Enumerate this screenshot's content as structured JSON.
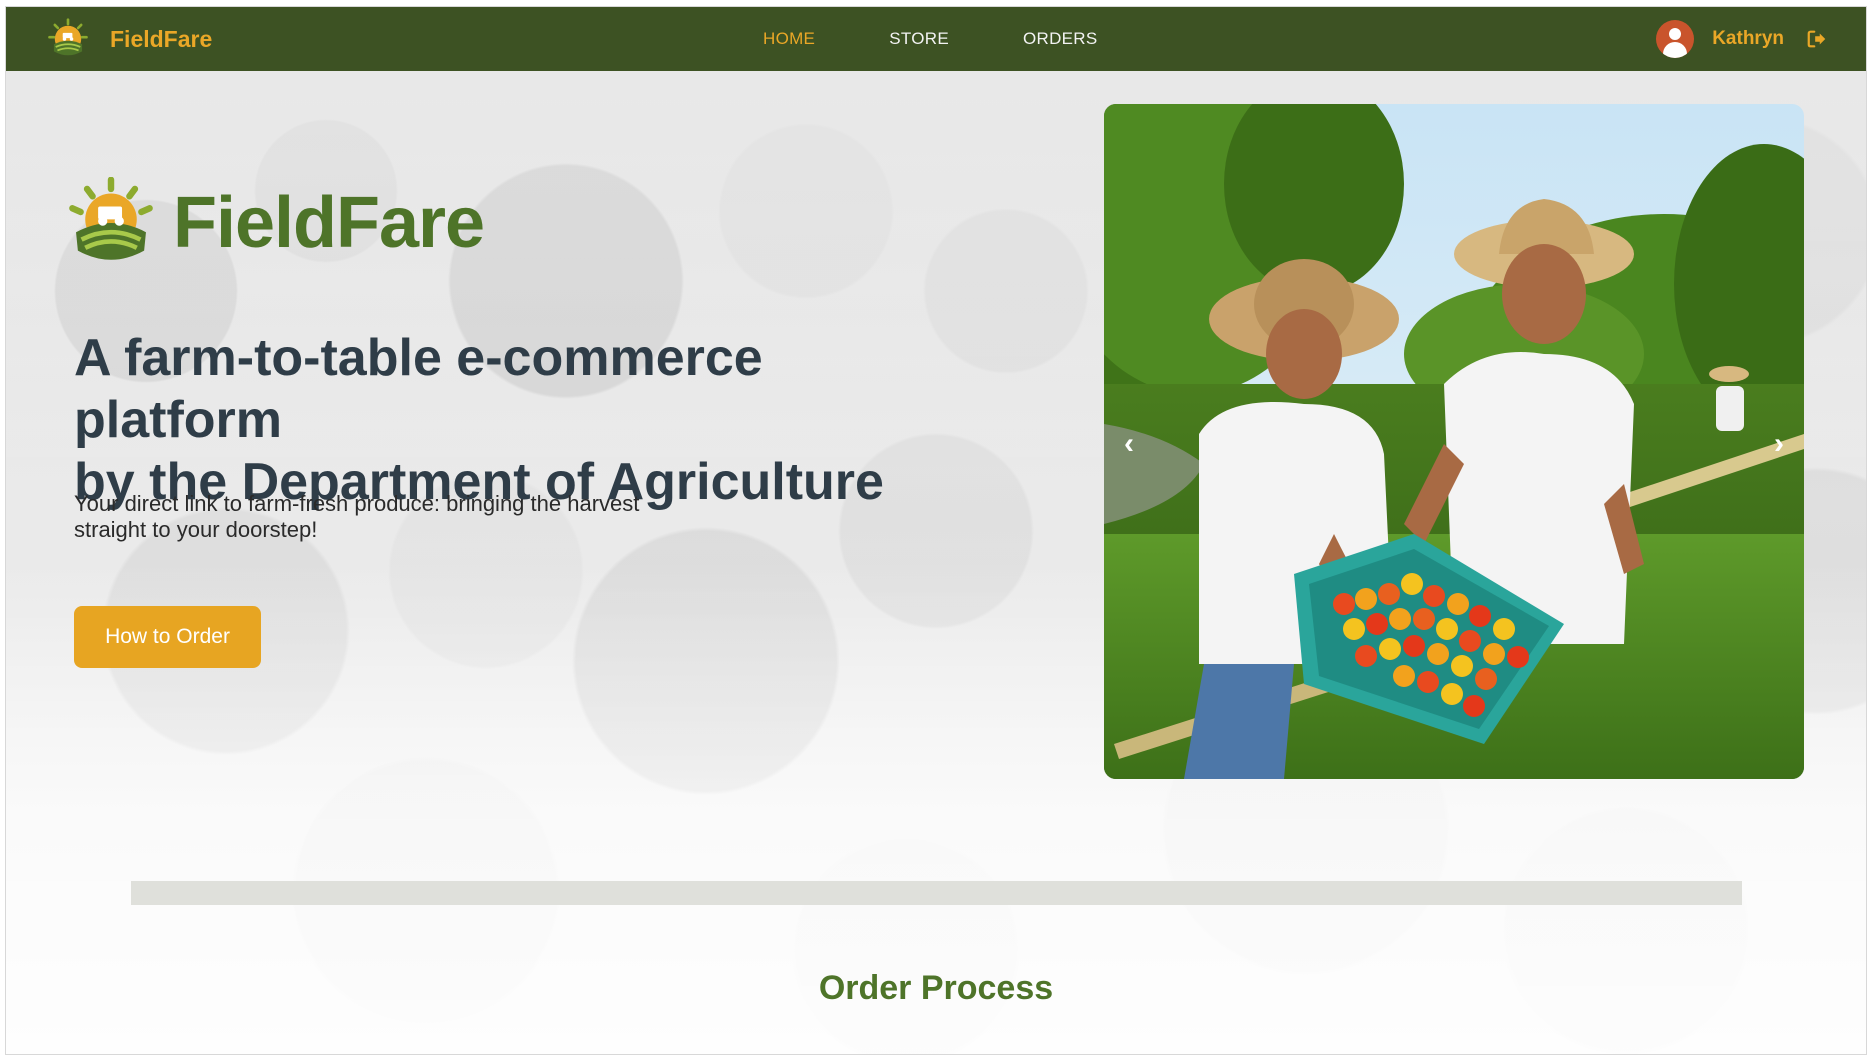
{
  "navbar": {
    "brand": "FieldFare",
    "links": [
      {
        "label": "HOME",
        "active": true
      },
      {
        "label": "STORE",
        "active": false
      },
      {
        "label": "ORDERS",
        "active": false
      }
    ],
    "user_name": "Kathryn"
  },
  "hero": {
    "brand": "FieldFare",
    "title_line1": "A farm-to-table e-commerce platform",
    "title_line2": "by the Department of Agriculture",
    "subtitle_line1": "Your direct link to farm-fresh produce: bringing the harvest",
    "subtitle_line2": "straight to your doorstep!",
    "cta_label": "How to Order"
  },
  "carousel": {
    "prev_label": "‹",
    "next_label": "›"
  },
  "section": {
    "title": "Order Process"
  },
  "colors": {
    "nav_bg": "#3d5223",
    "accent": "#e7a522",
    "brand_green": "#4e7429",
    "title_text": "#2f3d48"
  },
  "icons": {
    "logo": "fieldfare-logo-icon",
    "avatar": "user-avatar-icon",
    "logout": "logout-icon"
  }
}
